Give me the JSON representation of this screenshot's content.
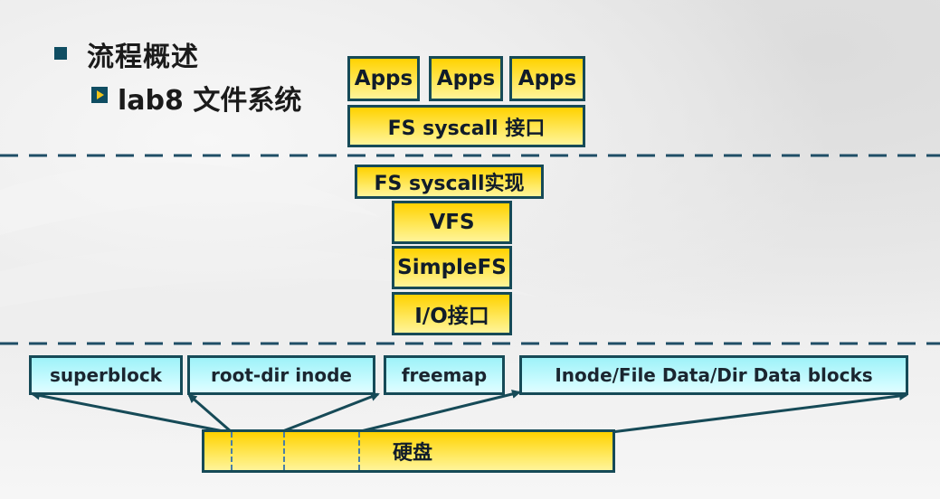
{
  "header": {
    "title": "流程概述",
    "subtitle": "lab8 文件系统"
  },
  "layers": {
    "apps": [
      "Apps",
      "Apps",
      "Apps"
    ],
    "fs_syscall_interface": "FS syscall 接口",
    "fs_syscall_impl": "FS syscall实现",
    "vfs": "VFS",
    "simplefs": "SimpleFS",
    "io_interface": "I/O接口"
  },
  "disk_layout": {
    "blocks": [
      "superblock",
      "root-dir inode",
      "freemap",
      "Inode/File Data/Dir Data blocks"
    ],
    "disk_label": "硬盘"
  },
  "colors": {
    "layer_fill": "#ffe14a",
    "block_fill": "#bff8fc",
    "border": "#164a57",
    "separator": "#1f4e66",
    "bullet": "#0f4d62"
  }
}
